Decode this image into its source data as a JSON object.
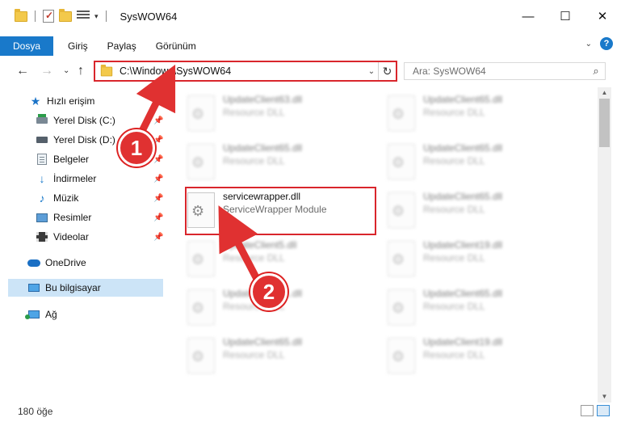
{
  "window": {
    "title": "SysWOW64",
    "minimize": "—",
    "maximize": "☐",
    "close": "✕"
  },
  "ribbon": {
    "tabs": [
      "Dosya",
      "Giriş",
      "Paylaş",
      "Görünüm"
    ],
    "help": "?"
  },
  "address": {
    "path": "C:\\Windows\\SysWOW64",
    "search_placeholder": "Ara: SysWOW64"
  },
  "sidebar": {
    "quick_access": "Hızlı erişim",
    "items": [
      {
        "label": "Yerel Disk (C:)",
        "icon": "drive-c-icon",
        "pinned": true
      },
      {
        "label": "Yerel Disk (D:)",
        "icon": "drive-d-icon",
        "pinned": true
      },
      {
        "label": "Belgeler",
        "icon": "documents-icon",
        "pinned": true
      },
      {
        "label": "İndirmeler",
        "icon": "downloads-icon",
        "pinned": true
      },
      {
        "label": "Müzik",
        "icon": "music-icon",
        "pinned": true
      },
      {
        "label": "Resimler",
        "icon": "pictures-icon",
        "pinned": true
      },
      {
        "label": "Videolar",
        "icon": "videos-icon",
        "pinned": true
      }
    ],
    "onedrive": "OneDrive",
    "this_pc": "Bu bilgisayar",
    "network": "Ağ"
  },
  "files": {
    "left_column": [
      {
        "name": "UpdateClient63.dll",
        "desc": "Resource DLL",
        "blurred": true
      },
      {
        "name": "UpdateClient65.dll",
        "desc": "Resource DLL",
        "blurred": true
      },
      {
        "name": "servicewrapper.dll",
        "desc": "ServiceWrapper Module",
        "blurred": false
      },
      {
        "name": "UpdateClient5.dll",
        "desc": "Resource DLL",
        "blurred": true
      },
      {
        "name": "UpdateClient21.dll",
        "desc": "Resource DLL",
        "blurred": true
      },
      {
        "name": "UpdateClient65.dll",
        "desc": "Resource DLL",
        "blurred": true
      }
    ],
    "right_column": [
      {
        "name": "UpdateClient65.dll",
        "desc": "Resource DLL",
        "blurred": true
      },
      {
        "name": "UpdateClient65.dll",
        "desc": "Resource DLL",
        "blurred": true
      },
      {
        "name": "UpdateClient65.dll",
        "desc": "Resource DLL",
        "blurred": true
      },
      {
        "name": "UpdateClient19.dll",
        "desc": "Resource DLL",
        "blurred": true
      },
      {
        "name": "UpdateClient65.dll",
        "desc": "Resource DLL",
        "blurred": true
      },
      {
        "name": "UpdateClient19.dll",
        "desc": "Resource DLL",
        "blurred": true
      }
    ]
  },
  "status": {
    "item_count": "180 öğe"
  },
  "annotations": {
    "step1": "1",
    "step2": "2",
    "color": "#e03131"
  }
}
